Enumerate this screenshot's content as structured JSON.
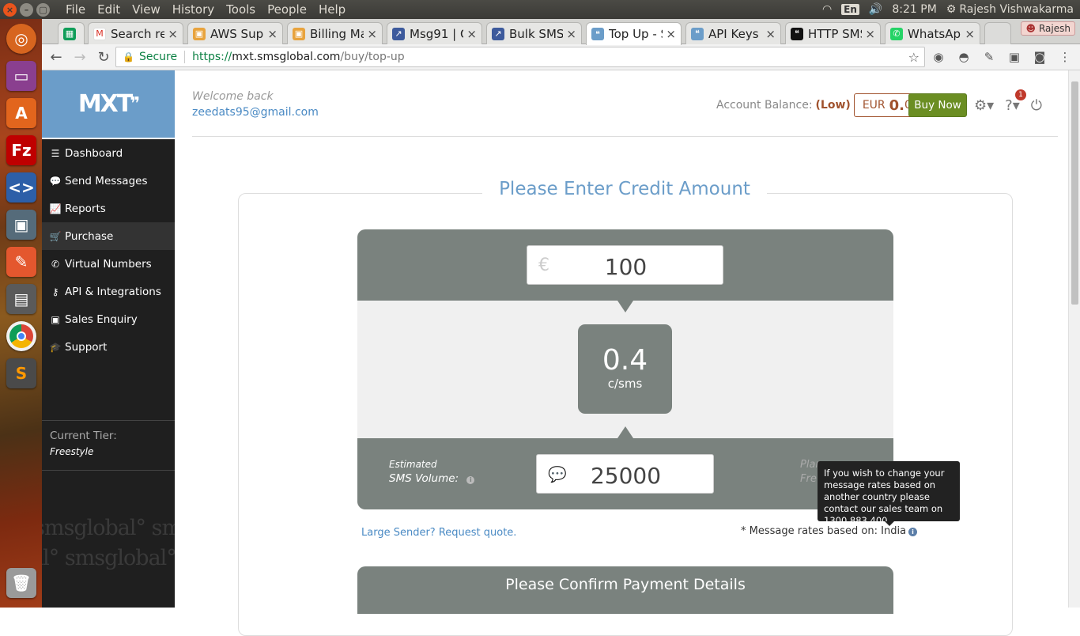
{
  "system": {
    "menus": [
      "File",
      "Edit",
      "View",
      "History",
      "Tools",
      "People",
      "Help"
    ],
    "lang": "En",
    "time": "8:21 PM",
    "user": "Rajesh Vishwakarma"
  },
  "browser": {
    "tabs": [
      {
        "title": "",
        "icon": "sheets-icon",
        "color": "#0f9d58"
      },
      {
        "title": "Search re",
        "icon": "gmail-icon",
        "color": "#d93025"
      },
      {
        "title": "AWS Sup",
        "icon": "aws-box-icon",
        "color": "#e8a33d"
      },
      {
        "title": "Billing Ma",
        "icon": "aws-box-icon",
        "color": "#e8a33d"
      },
      {
        "title": "Msg91 | C",
        "icon": "chart-icon",
        "color": "#3d5a9c"
      },
      {
        "title": "Bulk SMS",
        "icon": "chart-icon",
        "color": "#3d5a9c"
      },
      {
        "title": "Top Up - S",
        "icon": "smsglobal-icon",
        "color": "#6b9dc9"
      },
      {
        "title": "API Keys -",
        "icon": "smsglobal-icon",
        "color": "#6b9dc9"
      },
      {
        "title": "HTTP SMS",
        "icon": "smsglobal-icon",
        "color": "#111111"
      },
      {
        "title": "WhatsAp",
        "icon": "whatsapp-icon",
        "color": "#25d366"
      }
    ],
    "profile": "Rajesh",
    "url": {
      "secure": "Secure",
      "scheme": "https://",
      "host": "mxt.smsglobal.com",
      "path": "/buy/top-up"
    }
  },
  "sidebar": {
    "logo": "MXT",
    "items": [
      {
        "label": "Dashboard",
        "icon": "menu-icon"
      },
      {
        "label": "Send Messages",
        "icon": "speech-bubble-icon"
      },
      {
        "label": "Reports",
        "icon": "line-chart-icon"
      },
      {
        "label": "Purchase",
        "icon": "cart-icon"
      },
      {
        "label": "Virtual Numbers",
        "icon": "phone-icon"
      },
      {
        "label": "API & Integrations",
        "icon": "key-icon"
      },
      {
        "label": "Sales Enquiry",
        "icon": "money-icon"
      },
      {
        "label": "Support",
        "icon": "graduation-cap-icon"
      }
    ],
    "tier_label": "Current Tier:",
    "tier_value": "Freestyle",
    "watermark": [
      "smsglobal° smsglob",
      "al° smsglobal° sm"
    ]
  },
  "header": {
    "welcome": "Welcome back",
    "email": "zeedats95@gmail.com",
    "balance_label": "Account Balance:",
    "balance_status": "(Low)",
    "balance_currency": "EUR",
    "balance_int": "0.",
    "balance_dec": "00",
    "buy_now": "Buy Now",
    "help_badge": "1"
  },
  "topup": {
    "title": "Please Enter Credit Amount",
    "currency_symbol": "€",
    "amount": "100",
    "rate": "0.4",
    "rate_unit": "c/sms",
    "estimated_label": "Estimated",
    "sms_volume_label": "SMS Volume:",
    "sms_volume": "25000",
    "plan_label": "Plan",
    "plan_value": "Fre",
    "tooltip": "If you wish to change your message rates based on another country please contact our sales team on 1300 883 400",
    "large_sender": "Large Sender? Request quote.",
    "rates_based": "* Message rates based on: India",
    "confirm_title": "Please Confirm Payment Details"
  }
}
